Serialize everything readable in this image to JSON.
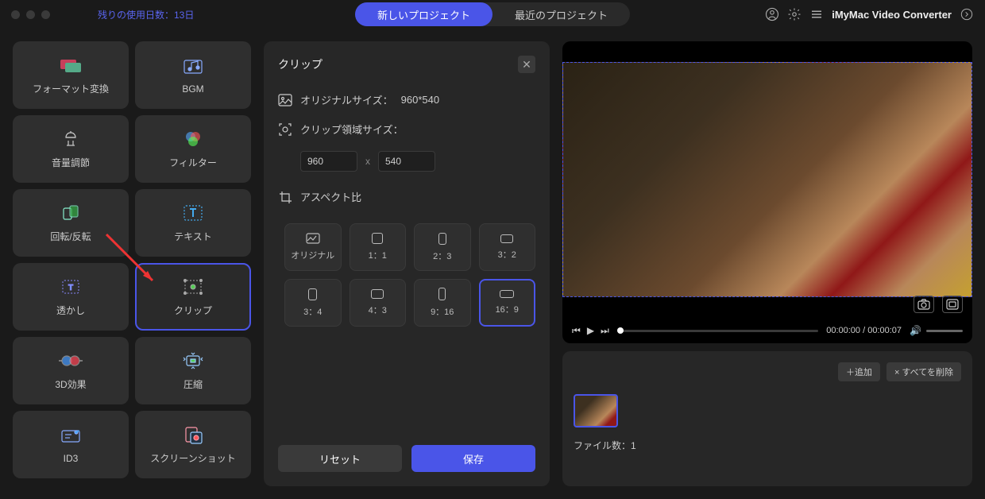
{
  "header": {
    "trial_text": "残りの使用日数：13日",
    "tab_new": "新しいプロジェクト",
    "tab_recent": "最近のプロジェクト",
    "app_name": "iMyMac Video Converter"
  },
  "sidebar": {
    "tools": [
      {
        "label": "フォーマット変換",
        "name": "format-convert"
      },
      {
        "label": "BGM",
        "name": "bgm"
      },
      {
        "label": "音量調節",
        "name": "volume-adjust"
      },
      {
        "label": "フィルター",
        "name": "filter"
      },
      {
        "label": "回転/反転",
        "name": "rotate-flip"
      },
      {
        "label": "テキスト",
        "name": "text"
      },
      {
        "label": "透かし",
        "name": "watermark"
      },
      {
        "label": "クリップ",
        "name": "clip"
      },
      {
        "label": "3D効果",
        "name": "3d-effect"
      },
      {
        "label": "圧縮",
        "name": "compress"
      },
      {
        "label": "ID3",
        "name": "id3"
      },
      {
        "label": "スクリーンショット",
        "name": "screenshot"
      }
    ]
  },
  "panel": {
    "title": "クリップ",
    "original_size_label": "オリジナルサイズ：",
    "original_size_value": "960*540",
    "clip_area_label": "クリップ領域サイズ：",
    "width_value": "960",
    "height_value": "540",
    "x_separator": "x",
    "aspect_label": "アスペクト比",
    "aspects": [
      {
        "label": "オリジナル",
        "w": 18,
        "h": 14
      },
      {
        "label": "1：1",
        "w": 14,
        "h": 14
      },
      {
        "label": "2：3",
        "w": 10,
        "h": 15
      },
      {
        "label": "3：2",
        "w": 16,
        "h": 11
      },
      {
        "label": "3：4",
        "w": 11,
        "h": 15
      },
      {
        "label": "4：3",
        "w": 16,
        "h": 12
      },
      {
        "label": "9：16",
        "w": 9,
        "h": 16
      },
      {
        "label": "16：9",
        "w": 18,
        "h": 10
      }
    ],
    "reset_label": "リセット",
    "save_label": "保存"
  },
  "player": {
    "time_current": "00:00:00",
    "time_total": "00:00:07"
  },
  "files": {
    "add_label": "＋追加",
    "delete_all_label": "× すべてを削除",
    "count_label": "ファイル数：1"
  }
}
